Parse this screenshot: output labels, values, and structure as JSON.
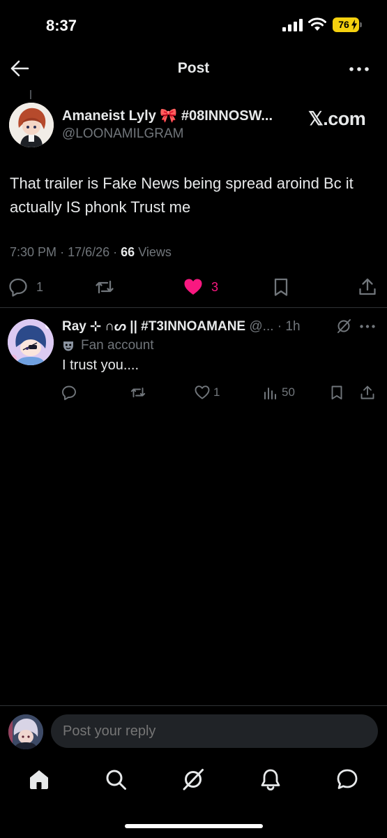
{
  "status_bar": {
    "time": "8:37",
    "battery": "76"
  },
  "header": {
    "title": "Post",
    "back_icon": "arrow-left-icon",
    "more_icon": "more-horizontal-icon"
  },
  "post": {
    "author_name": "Amaneist Lyly 🎀 #08INNOSW...",
    "handle": "@LOONAMILGRAM",
    "source_badge": "𝕏.com",
    "text": "That trailer is Fake News being spread aroind Bc it actually IS phonk Trust me",
    "time": "7:30 PM",
    "date": "17/6/26",
    "views_count": "66",
    "views_label": "Views",
    "replies": "1",
    "likes": "3",
    "like_color": "#f91880"
  },
  "reply": {
    "name": "Ray ⊹ ∩ᔕ || #T3INNOAMANE",
    "handle": "@...",
    "time": "1h",
    "badge_icon": "mask-icon",
    "badge": "Fan account",
    "text": "I trust you....",
    "likes": "1",
    "views": "50"
  },
  "composer": {
    "placeholder": "Post your reply"
  },
  "nav": [
    "home-icon",
    "search-icon",
    "grok-icon",
    "notifications-icon",
    "messages-icon"
  ],
  "colors": {
    "background": "#000000",
    "text": "#e7e9ea",
    "muted": "#71767b",
    "divider": "#2f3336",
    "battery": "#f5d10f"
  }
}
